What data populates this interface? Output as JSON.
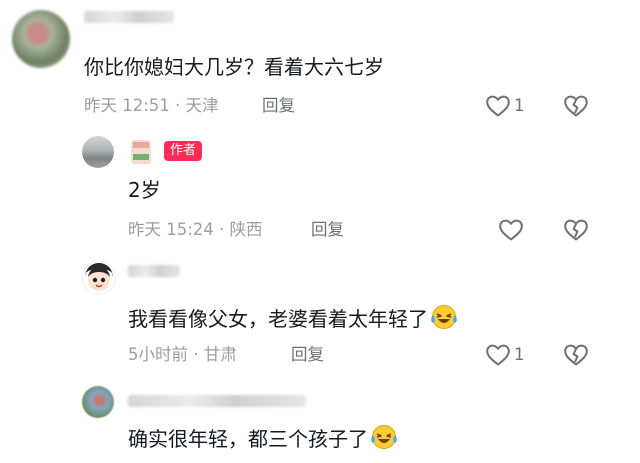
{
  "comments": [
    {
      "text": "你比你媳妇大几岁？看着大六七岁",
      "time": "昨天 12:51",
      "location": "天津",
      "reply_label": "回复",
      "likes": "1"
    },
    {
      "author_badge": "作者",
      "text": "2岁",
      "time": "昨天 15:24",
      "location": "陕西",
      "reply_label": "回复",
      "likes": ""
    },
    {
      "text": "我看看像父女，老婆看着太年轻了",
      "emoji": "crying-laughing-emoji",
      "time": "5小时前",
      "location": "甘肃",
      "reply_label": "回复",
      "likes": "1"
    },
    {
      "text": "确实很年轻，都三个孩子了",
      "emoji": "crying-laughing-emoji"
    }
  ],
  "colors": {
    "badge": "#fe2c55",
    "meta": "#9c9ca3",
    "text": "#161823"
  },
  "icons": [
    "heart-outline-icon",
    "broken-heart-icon"
  ]
}
